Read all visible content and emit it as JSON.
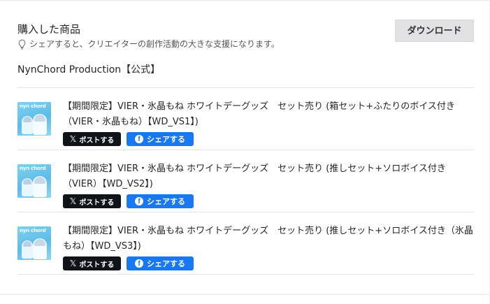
{
  "header": {
    "title": "購入した商品",
    "hint": "シェアすると、クリエイターの創作活動の大きな支援になります。",
    "hint_icon": "lightbulb-icon",
    "download_label": "ダウンロード"
  },
  "shop": {
    "name": "NynChord Production【公式】"
  },
  "items": [
    {
      "thumb_logo": "nyn chord",
      "title": "【期間限定】VIER・氷晶もね ホワイトデーグッズ　セット売り (箱セット+ふたりのボイス付き（VIER・氷晶もね）【WD_VS1】)",
      "x_label": "ポストする",
      "fb_label": "シェアする"
    },
    {
      "thumb_logo": "nyn chord",
      "title": "【期間限定】VIER・氷晶もね ホワイトデーグッズ　セット売り (推しセット+ソロボイス付き（VIER）【WD_VS2】)",
      "x_label": "ポストする",
      "fb_label": "シェアする"
    },
    {
      "thumb_logo": "nyn chord",
      "title": "【期間限定】VIER・氷晶もね ホワイトデーグッズ　セット売り (推しセット+ソロボイス付き（氷晶もね）【WD_VS3】)",
      "x_label": "ポストする",
      "fb_label": "シェアする"
    }
  ],
  "colors": {
    "x_button": "#0f1419",
    "facebook_button": "#1877f2",
    "download_button": "#e2e2e4"
  }
}
